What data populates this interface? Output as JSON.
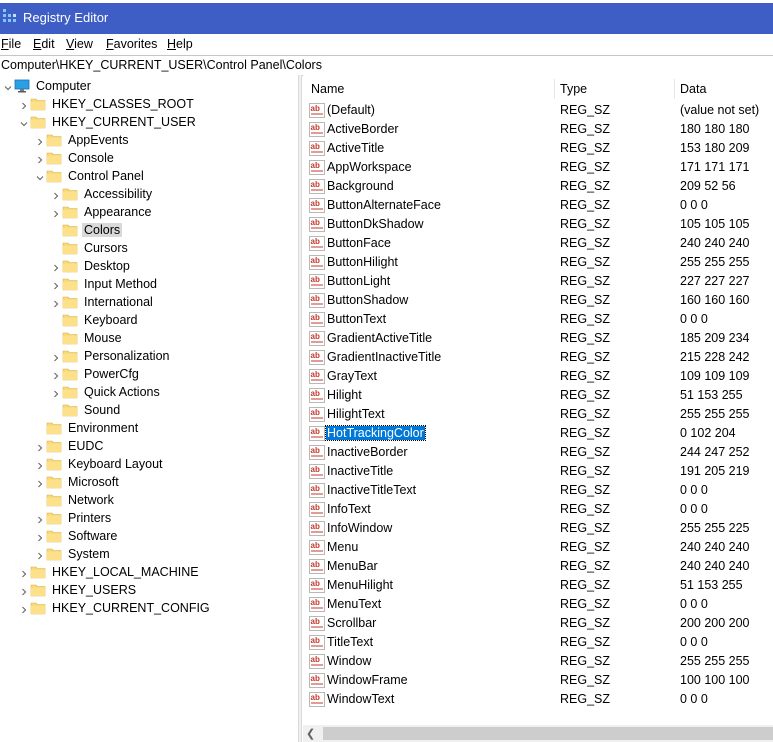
{
  "window": {
    "title": "Registry Editor"
  },
  "menu": [
    {
      "label": "File",
      "u": "F",
      "rest": "ile"
    },
    {
      "label": "Edit",
      "u": "E",
      "rest": "dit"
    },
    {
      "label": "View",
      "u": "V",
      "rest": "iew"
    },
    {
      "label": "Favorites",
      "u": "F",
      "rest": "avorites"
    },
    {
      "label": "Help",
      "u": "H",
      "rest": "elp"
    }
  ],
  "address": "Computer\\HKEY_CURRENT_USER\\Control Panel\\Colors",
  "tree": [
    {
      "label": "Computer",
      "depth": 0,
      "expander": "open",
      "icon": "computer"
    },
    {
      "label": "HKEY_CLASSES_ROOT",
      "depth": 1,
      "expander": "closed"
    },
    {
      "label": "HKEY_CURRENT_USER",
      "depth": 1,
      "expander": "open"
    },
    {
      "label": "AppEvents",
      "depth": 2,
      "expander": "closed"
    },
    {
      "label": "Console",
      "depth": 2,
      "expander": "closed"
    },
    {
      "label": "Control Panel",
      "depth": 2,
      "expander": "open"
    },
    {
      "label": "Accessibility",
      "depth": 3,
      "expander": "closed"
    },
    {
      "label": "Appearance",
      "depth": 3,
      "expander": "closed"
    },
    {
      "label": "Colors",
      "depth": 3,
      "expander": "none",
      "selected": true
    },
    {
      "label": "Cursors",
      "depth": 3,
      "expander": "none"
    },
    {
      "label": "Desktop",
      "depth": 3,
      "expander": "closed"
    },
    {
      "label": "Input Method",
      "depth": 3,
      "expander": "closed"
    },
    {
      "label": "International",
      "depth": 3,
      "expander": "closed"
    },
    {
      "label": "Keyboard",
      "depth": 3,
      "expander": "none"
    },
    {
      "label": "Mouse",
      "depth": 3,
      "expander": "none"
    },
    {
      "label": "Personalization",
      "depth": 3,
      "expander": "closed"
    },
    {
      "label": "PowerCfg",
      "depth": 3,
      "expander": "closed"
    },
    {
      "label": "Quick Actions",
      "depth": 3,
      "expander": "closed"
    },
    {
      "label": "Sound",
      "depth": 3,
      "expander": "none"
    },
    {
      "label": "Environment",
      "depth": 2,
      "expander": "none"
    },
    {
      "label": "EUDC",
      "depth": 2,
      "expander": "closed"
    },
    {
      "label": "Keyboard Layout",
      "depth": 2,
      "expander": "closed"
    },
    {
      "label": "Microsoft",
      "depth": 2,
      "expander": "closed"
    },
    {
      "label": "Network",
      "depth": 2,
      "expander": "none"
    },
    {
      "label": "Printers",
      "depth": 2,
      "expander": "closed"
    },
    {
      "label": "Software",
      "depth": 2,
      "expander": "closed"
    },
    {
      "label": "System",
      "depth": 2,
      "expander": "closed"
    },
    {
      "label": "HKEY_LOCAL_MACHINE",
      "depth": 1,
      "expander": "closed"
    },
    {
      "label": "HKEY_USERS",
      "depth": 1,
      "expander": "closed"
    },
    {
      "label": "HKEY_CURRENT_CONFIG",
      "depth": 1,
      "expander": "closed"
    }
  ],
  "columns": {
    "name": "Name",
    "type": "Type",
    "data": "Data"
  },
  "values": [
    {
      "name": "(Default)",
      "type": "REG_SZ",
      "data": "(value not set)"
    },
    {
      "name": "ActiveBorder",
      "type": "REG_SZ",
      "data": "180 180 180"
    },
    {
      "name": "ActiveTitle",
      "type": "REG_SZ",
      "data": "153 180 209"
    },
    {
      "name": "AppWorkspace",
      "type": "REG_SZ",
      "data": "171 171 171"
    },
    {
      "name": "Background",
      "type": "REG_SZ",
      "data": "209 52 56"
    },
    {
      "name": "ButtonAlternateFace",
      "type": "REG_SZ",
      "data": "0 0 0"
    },
    {
      "name": "ButtonDkShadow",
      "type": "REG_SZ",
      "data": "105 105 105"
    },
    {
      "name": "ButtonFace",
      "type": "REG_SZ",
      "data": "240 240 240"
    },
    {
      "name": "ButtonHilight",
      "type": "REG_SZ",
      "data": "255 255 255"
    },
    {
      "name": "ButtonLight",
      "type": "REG_SZ",
      "data": "227 227 227"
    },
    {
      "name": "ButtonShadow",
      "type": "REG_SZ",
      "data": "160 160 160"
    },
    {
      "name": "ButtonText",
      "type": "REG_SZ",
      "data": "0 0 0"
    },
    {
      "name": "GradientActiveTitle",
      "type": "REG_SZ",
      "data": "185 209 234"
    },
    {
      "name": "GradientInactiveTitle",
      "type": "REG_SZ",
      "data": "215 228 242"
    },
    {
      "name": "GrayText",
      "type": "REG_SZ",
      "data": "109 109 109"
    },
    {
      "name": "Hilight",
      "type": "REG_SZ",
      "data": "51 153 255"
    },
    {
      "name": "HilightText",
      "type": "REG_SZ",
      "data": "255 255 255"
    },
    {
      "name": "HotTrackingColor",
      "type": "REG_SZ",
      "data": "0 102 204",
      "selected": true
    },
    {
      "name": "InactiveBorder",
      "type": "REG_SZ",
      "data": "244 247 252"
    },
    {
      "name": "InactiveTitle",
      "type": "REG_SZ",
      "data": "191 205 219"
    },
    {
      "name": "InactiveTitleText",
      "type": "REG_SZ",
      "data": "0 0 0"
    },
    {
      "name": "InfoText",
      "type": "REG_SZ",
      "data": "0 0 0"
    },
    {
      "name": "InfoWindow",
      "type": "REG_SZ",
      "data": "255 255 225"
    },
    {
      "name": "Menu",
      "type": "REG_SZ",
      "data": "240 240 240"
    },
    {
      "name": "MenuBar",
      "type": "REG_SZ",
      "data": "240 240 240"
    },
    {
      "name": "MenuHilight",
      "type": "REG_SZ",
      "data": "51 153 255"
    },
    {
      "name": "MenuText",
      "type": "REG_SZ",
      "data": "0 0 0"
    },
    {
      "name": "Scrollbar",
      "type": "REG_SZ",
      "data": "200 200 200"
    },
    {
      "name": "TitleText",
      "type": "REG_SZ",
      "data": "0 0 0"
    },
    {
      "name": "Window",
      "type": "REG_SZ",
      "data": "255 255 255"
    },
    {
      "name": "WindowFrame",
      "type": "REG_SZ",
      "data": "100 100 100"
    },
    {
      "name": "WindowText",
      "type": "REG_SZ",
      "data": "0 0 0"
    }
  ],
  "colors": {
    "title_bar": "#3e5ec6",
    "selection": "#0078d7",
    "folder": "#f8d775"
  }
}
